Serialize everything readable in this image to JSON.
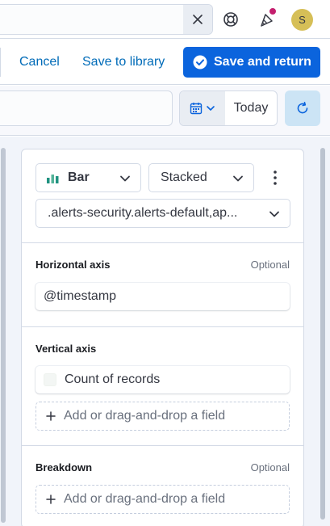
{
  "header": {
    "clear_icon": "close-icon",
    "help_icon": "lifebuoy-icon",
    "news_icon": "cheer-icon",
    "avatar_initial": "S",
    "avatar_color": "#d6bf57",
    "notification_color": "#c41f6e"
  },
  "actions": {
    "cancel_label": "Cancel",
    "save_library_label": "Save to library",
    "save_return_label": "Save and return",
    "primary_color": "#0b64dd"
  },
  "query": {
    "date_label": "Today",
    "calendar_icon": "calendar-icon",
    "refresh_icon": "refresh-icon"
  },
  "config": {
    "chart_type": "Bar",
    "stacking": "Stacked",
    "data_view": ".alerts-security.alerts-default,ap...",
    "horizontal_axis": {
      "title": "Horizontal axis",
      "optional": "Optional",
      "field": "@timestamp"
    },
    "vertical_axis": {
      "title": "Vertical axis",
      "field": "Count of records",
      "add_label": "Add or drag-and-drop a field"
    },
    "breakdown": {
      "title": "Breakdown",
      "optional": "Optional",
      "add_label": "Add or drag-and-drop a field"
    }
  }
}
